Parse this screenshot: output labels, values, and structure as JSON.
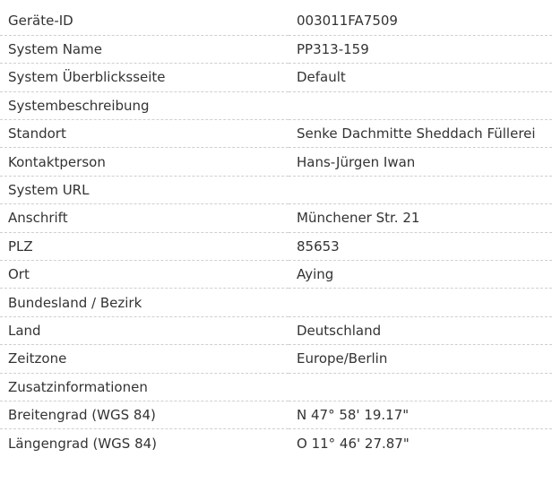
{
  "rows": [
    {
      "label": "Geräte-ID",
      "value": "003011FA7509"
    },
    {
      "label": "System Name",
      "value": "PP313-159"
    },
    {
      "label": "System Überblicksseite",
      "value": "Default"
    },
    {
      "label": "Systembeschreibung",
      "value": ""
    },
    {
      "label": "Standort",
      "value": "Senke Dachmitte Sheddach Füllerei"
    },
    {
      "label": "Kontaktperson",
      "value": "Hans-Jürgen Iwan"
    },
    {
      "label": "System URL",
      "value": ""
    },
    {
      "label": "Anschrift",
      "value": "Münchener Str. 21"
    },
    {
      "label": "PLZ",
      "value": "85653"
    },
    {
      "label": "Ort",
      "value": "Aying"
    },
    {
      "label": "Bundesland / Bezirk",
      "value": ""
    },
    {
      "label": "Land",
      "value": "Deutschland"
    },
    {
      "label": "Zeitzone",
      "value": "Europe/Berlin"
    },
    {
      "label": "Zusatzinformationen",
      "value": ""
    },
    {
      "label": "Breitengrad (WGS 84)",
      "value": "N 47° 58' 19.17\""
    },
    {
      "label": "Längengrad (WGS 84)",
      "value": "O 11° 46' 27.87\""
    }
  ]
}
